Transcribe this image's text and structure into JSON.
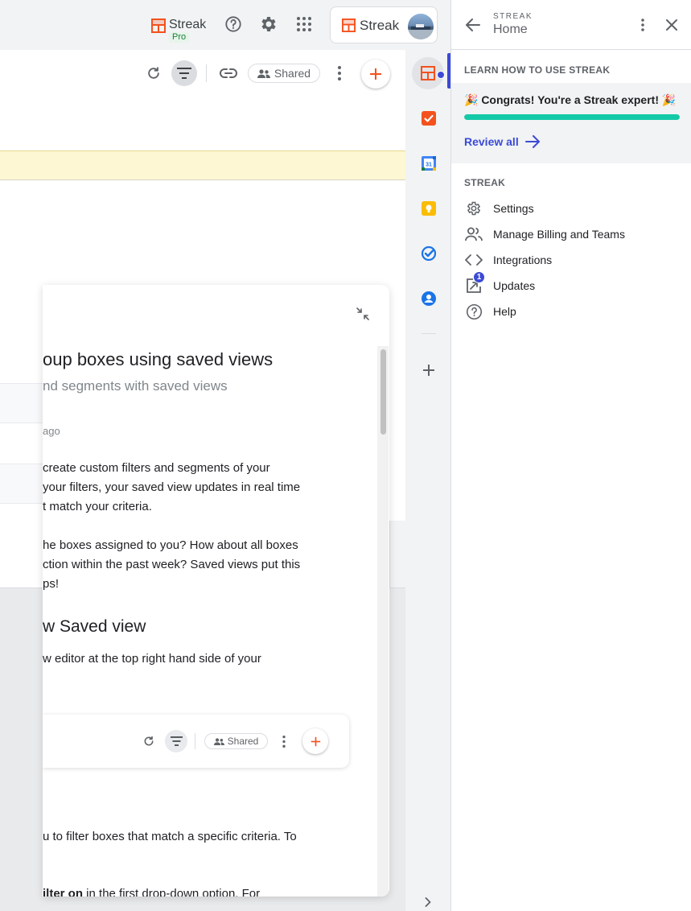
{
  "header": {
    "streak_name": "Streak",
    "pro_badge": "Pro",
    "account_label": "Streak"
  },
  "toolbar": {
    "shared_label": "Shared"
  },
  "article": {
    "title": "oup boxes using saved views",
    "subtitle": "nd segments with saved views",
    "meta": "ago",
    "para1": [
      "create custom filters and segments of your",
      "your filters, your saved view updates in real time",
      "t match your criteria."
    ],
    "para2": [
      "he boxes assigned to you? How about all boxes",
      "ction within the past week? Saved views put this",
      "ps!"
    ],
    "heading2": "w Saved view",
    "para3": "w editor at the top right hand side of your",
    "embed_shared_label": "Shared",
    "para4": "u to filter boxes that match a specific criteria. To",
    "para5_bold": "ilter on",
    "para5_rest": " in the first drop-down option. For"
  },
  "panel": {
    "eyebrow": "STREAK",
    "title": "Home",
    "learn_heading": "LEARN HOW TO USE STREAK",
    "congrats": "🎉 Congrats! You're a Streak expert! 🎉",
    "progress_fraction": 1.0,
    "review_label": "Review all",
    "streak_heading": "STREAK",
    "menu": [
      {
        "label": "Settings",
        "icon": "gear-icon"
      },
      {
        "label": "Manage Billing and Teams",
        "icon": "people-icon"
      },
      {
        "label": "Integrations",
        "icon": "code-icon"
      },
      {
        "label": "Updates",
        "icon": "updates-icon",
        "badge": "1"
      },
      {
        "label": "Help",
        "icon": "help-icon"
      }
    ]
  },
  "colors": {
    "streak_orange": "#f4511e",
    "streak_blue": "#3c4ad6",
    "progress_teal": "#14c9a7",
    "notice_yellow": "#fef7d4"
  }
}
